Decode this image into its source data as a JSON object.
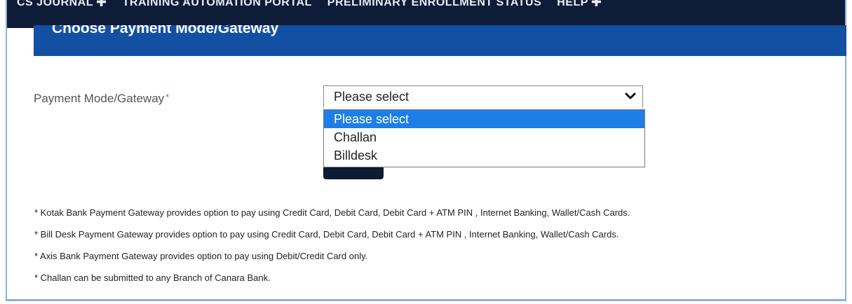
{
  "nav": {
    "items": [
      {
        "label": "CS JOURNAL",
        "plus": "✚"
      },
      {
        "label": "TRAINING AUTOMATION PORTAL",
        "plus": ""
      },
      {
        "label": "PRELIMINARY ENROLLMENT STATUS",
        "plus": ""
      },
      {
        "label": "HELP",
        "plus": "✚"
      }
    ]
  },
  "section": {
    "title": "Choose Payment Mode/Gateway"
  },
  "form": {
    "label": "Payment Mode/Gateway",
    "required_mark": "*",
    "select": {
      "value": "Please select",
      "options": [
        "Please select",
        "Challan",
        "Billdesk"
      ],
      "selected_index": 0
    }
  },
  "notes": [
    "* Kotak Bank Payment Gateway provides option to pay using Credit Card, Debit Card, Debit Card + ATM PIN , Internet Banking, Wallet/Cash Cards.",
    "* Bill Desk Payment Gateway provides option to pay using Credit Card, Debit Card, Debit Card + ATM PIN , Internet Banking, Wallet/Cash Cards.",
    "* Axis Bank Payment Gateway provides option to pay using Debit/Credit Card only.",
    "* Challan can be submitted to any Branch of Canara Bank."
  ],
  "colors": {
    "nav_bg": "#0f1c37",
    "title_band": "#134fa3",
    "highlight": "#1d7ee6",
    "required": "#d84a4a"
  },
  "icons": {
    "select_toggle": "chevron-down-icon"
  }
}
